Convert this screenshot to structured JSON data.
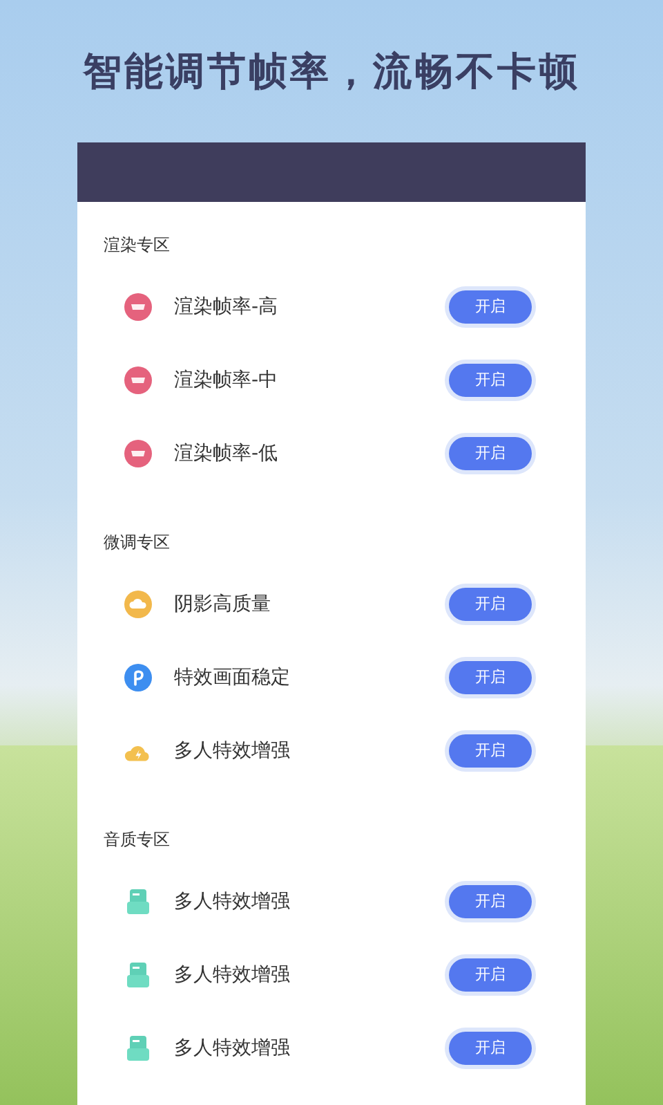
{
  "headline": "智能调节帧率，流畅不卡顿",
  "sections": [
    {
      "title": "渲染专区",
      "items": [
        {
          "kind": "badge",
          "label": "渲染帧率-高",
          "button": "开启"
        },
        {
          "kind": "badge",
          "label": "渲染帧率-中",
          "button": "开启"
        },
        {
          "kind": "badge",
          "label": "渲染帧率-低",
          "button": "开启"
        }
      ]
    },
    {
      "title": "微调专区",
      "items": [
        {
          "kind": "cloud",
          "label": "阴影高质量",
          "button": "开启"
        },
        {
          "kind": "pen",
          "label": "特效画面稳定",
          "button": "开启"
        },
        {
          "kind": "bolt",
          "label": "多人特效增强",
          "button": "开启"
        }
      ]
    },
    {
      "title": "音质专区",
      "items": [
        {
          "kind": "tray",
          "label": "多人特效增强",
          "button": "开启"
        },
        {
          "kind": "tray",
          "label": "多人特效增强",
          "button": "开启"
        },
        {
          "kind": "tray",
          "label": "多人特效增强",
          "button": "开启"
        }
      ]
    }
  ]
}
